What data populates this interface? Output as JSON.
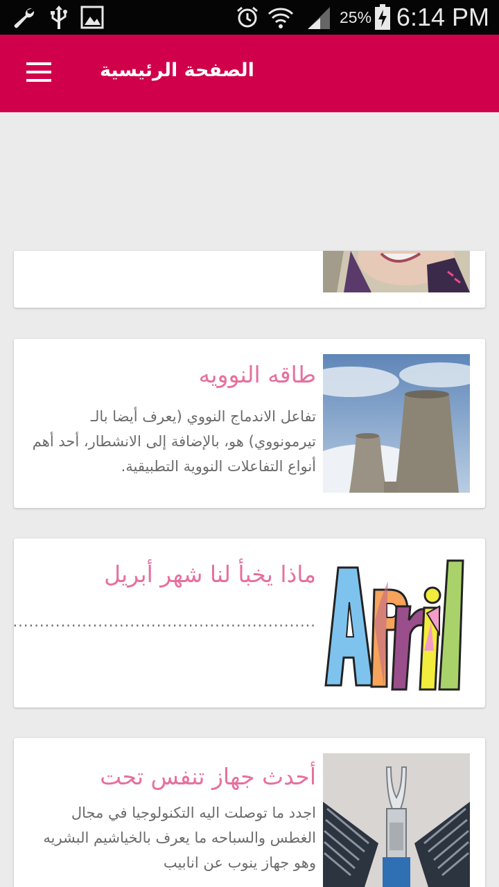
{
  "status_bar": {
    "battery_percent": "25%",
    "time": "6:14 PM",
    "icons": [
      "wrench-icon",
      "usb-icon",
      "image-icon",
      "alarm-icon",
      "wifi-icon",
      "signal-icon",
      "battery-charging-icon"
    ]
  },
  "app_bar": {
    "title": "الصفحة الرئيسية",
    "menu_icon": "hamburger-menu-icon",
    "color": "#d0004b"
  },
  "articles": [
    {
      "title": "",
      "description": "",
      "image": "woman-portrait"
    },
    {
      "title": "طاقه النوويه",
      "description": "تفاعل الاندماج النووي (يعرف أيضا بالـ تيرمونووي) هو، بالإضافة إلى الانشطار، أحد أهم أنواع التفاعلات النووية التطبيقية.",
      "image": "cooling-towers"
    },
    {
      "title": "ماذا يخبأ لنا شهر أبريل",
      "description": "...................................................................................................................",
      "image": "april-word-art"
    },
    {
      "title": "أحدث جهاز تنفس تحت",
      "description": "اجدد ما توصلت اليه التكنولوجيا في مجال الغطس والسباحه ما يعرف بالخياشيم البشريه وهو جهاز ينوب عن انابيب",
      "image": "breathing-device"
    }
  ],
  "colors": {
    "accent": "#d0004b",
    "title_pink": "#e6709e",
    "background": "#ebebeb"
  }
}
